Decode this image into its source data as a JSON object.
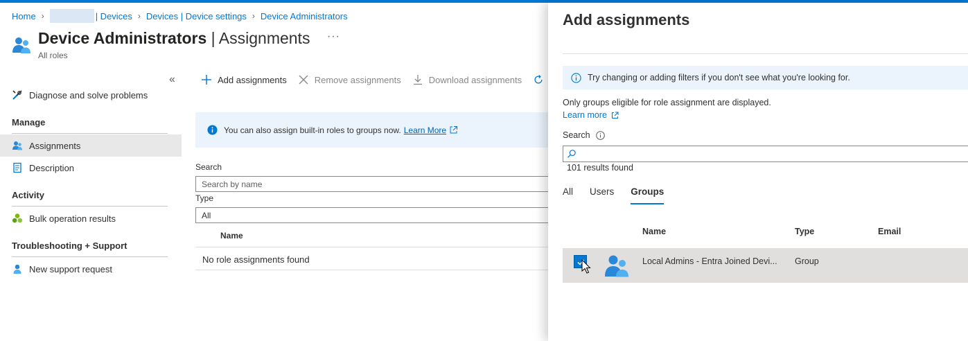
{
  "breadcrumb": {
    "home": "Home",
    "devices": "| Devices",
    "device_settings": "Devices | Device settings",
    "current": "Device Administrators"
  },
  "page": {
    "title_bold": "Device Administrators",
    "title_rest": " | Assignments",
    "more": "···",
    "subtitle": "All roles"
  },
  "nav": {
    "collapse": "«",
    "diagnose": "Diagnose and solve problems",
    "manage_header": "Manage",
    "assignments": "Assignments",
    "description": "Description",
    "activity_header": "Activity",
    "bulk": "Bulk operation results",
    "support_header": "Troubleshooting + Support",
    "new_support": "New support request"
  },
  "toolbar": {
    "add": "Add assignments",
    "remove": "Remove assignments",
    "download": "Download assignments",
    "refresh": "R"
  },
  "info": {
    "text": "You can also assign built-in roles to groups now.",
    "link": "Learn More"
  },
  "filters": {
    "search_label": "Search",
    "search_placeholder": "Search by name",
    "type_label": "Type",
    "type_value": "All"
  },
  "grid": {
    "name_header": "Name",
    "empty": "No role assignments found"
  },
  "blade": {
    "title": "Add assignments",
    "banner": "Try changing or adding filters if you don't see what you're looking for.",
    "note": "Only groups eligible for role assignment are displayed.",
    "learn_more": "Learn more",
    "search_label": "Search",
    "results": "101 results found",
    "tabs": [
      "All",
      "Users",
      "Groups"
    ],
    "active_tab": "Groups",
    "columns": {
      "name": "Name",
      "type": "Type",
      "email": "Email"
    },
    "row": {
      "name": "Local Admins - Entra Joined Devi...",
      "type": "Group",
      "selected": true
    }
  },
  "colors": {
    "accent": "#0078d4",
    "info_bg": "#ebf3fc",
    "selected_row": "#e1dfdd"
  }
}
